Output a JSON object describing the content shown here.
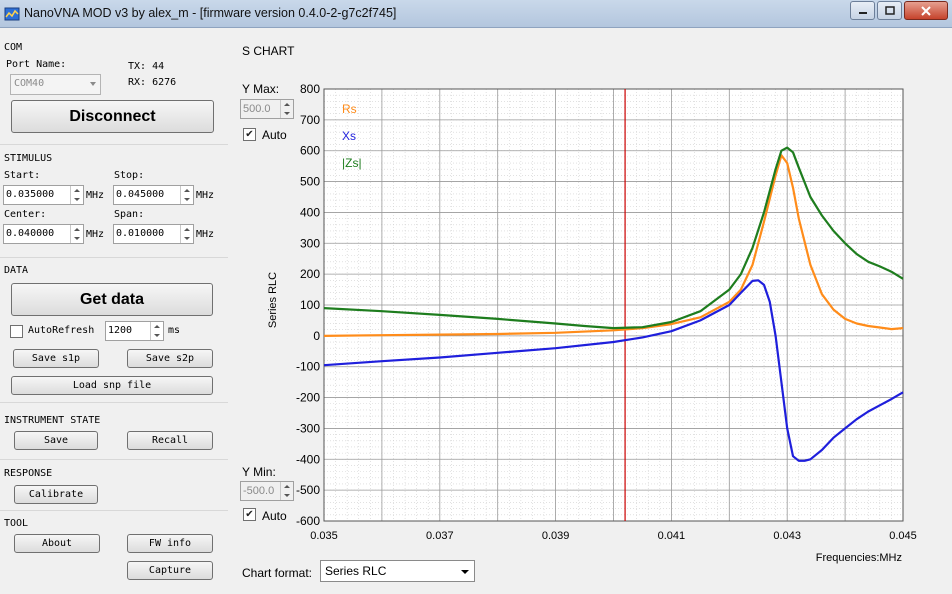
{
  "window": {
    "title": "NanoVNA MOD v3 by alex_m - [firmware version 0.4.0-2-g7c2f745]",
    "accent": "#b3c6de"
  },
  "com": {
    "title": "COM",
    "port_label": "Port Name:",
    "port_value": "COM40",
    "tx": "TX: 44",
    "rx": "RX: 6276",
    "disconnect_label": "Disconnect"
  },
  "stimulus": {
    "title": "STIMULUS",
    "start_label": "Start:",
    "start_value": "0.035000",
    "stop_label": "Stop:",
    "stop_value": "0.045000",
    "center_label": "Center:",
    "center_value": "0.040000",
    "span_label": "Span:",
    "span_value": "0.010000",
    "unit": "MHz"
  },
  "data_section": {
    "title": "DATA",
    "get_data_label": "Get data",
    "autorefresh_label": "AutoRefresh",
    "autorefresh_checked": false,
    "interval_value": "1200",
    "interval_unit": "ms",
    "save_s1p_label": "Save s1p",
    "save_s2p_label": "Save s2p",
    "load_snp_label": "Load snp file"
  },
  "instrument_state": {
    "title": "INSTRUMENT STATE",
    "save_label": "Save",
    "recall_label": "Recall"
  },
  "response": {
    "title": "RESPONSE",
    "calibrate_label": "Calibrate"
  },
  "tool": {
    "title": "TOOL",
    "about_label": "About",
    "fw_info_label": "FW info",
    "capture_label": "Capture"
  },
  "chart_panel": {
    "title": "S CHART",
    "y_max_label": "Y Max:",
    "y_max_value": "500.0",
    "y_max_auto_label": "Auto",
    "y_max_auto_checked": true,
    "y_min_label": "Y Min:",
    "y_min_value": "-500.0",
    "y_min_auto_label": "Auto",
    "y_min_auto_checked": true,
    "format_label": "Chart format:",
    "format_value": "Series RLC"
  },
  "chart_data": {
    "type": "line",
    "title": "",
    "xlabel": "Frequencies:MHz",
    "ylabel": "Series RLC",
    "xlim": [
      0.035,
      0.045
    ],
    "ylim": [
      -600,
      800
    ],
    "x_ticks": [
      "0.035",
      "0.037",
      "0.039",
      "0.041",
      "0.043",
      "0.045"
    ],
    "x_tick_values": [
      0.035,
      0.037,
      0.039,
      0.041,
      0.043,
      0.045
    ],
    "y_ticks": [
      800,
      700,
      600,
      500,
      400,
      300,
      200,
      100,
      0,
      -100,
      -200,
      -300,
      -400,
      -500,
      -600
    ],
    "grid": true,
    "legend_position": "top-left",
    "marker_x": 0.0402,
    "marker_color": "#cc0000",
    "series": [
      {
        "name": "Rs",
        "color": "#ff8c1a",
        "x": [
          0.035,
          0.036,
          0.037,
          0.038,
          0.039,
          0.04,
          0.0405,
          0.041,
          0.0415,
          0.042,
          0.0422,
          0.0424,
          0.0426,
          0.0428,
          0.0429,
          0.043,
          0.0431,
          0.0432,
          0.0434,
          0.0436,
          0.0438,
          0.044,
          0.0442,
          0.0444,
          0.0446,
          0.0448,
          0.045
        ],
        "y": [
          0,
          2,
          4,
          6,
          10,
          18,
          25,
          38,
          60,
          110,
          150,
          230,
          370,
          520,
          585,
          560,
          480,
          380,
          230,
          135,
          85,
          55,
          40,
          32,
          27,
          22,
          25
        ]
      },
      {
        "name": "Xs",
        "color": "#1f1fdc",
        "x": [
          0.035,
          0.036,
          0.037,
          0.038,
          0.039,
          0.04,
          0.0405,
          0.041,
          0.0415,
          0.042,
          0.0422,
          0.0424,
          0.0425,
          0.0426,
          0.0427,
          0.0428,
          0.0429,
          0.043,
          0.0431,
          0.0432,
          0.0433,
          0.0434,
          0.0436,
          0.0438,
          0.044,
          0.0442,
          0.0444,
          0.0446,
          0.0448,
          0.045
        ],
        "y": [
          -95,
          -82,
          -70,
          -55,
          -40,
          -20,
          -5,
          15,
          50,
          100,
          140,
          178,
          180,
          165,
          110,
          0,
          -150,
          -300,
          -390,
          -405,
          -405,
          -400,
          -370,
          -330,
          -300,
          -270,
          -245,
          -225,
          -205,
          -183
        ]
      },
      {
        "name": "|Zs|",
        "color": "#1e7d1e",
        "x": [
          0.035,
          0.036,
          0.037,
          0.038,
          0.039,
          0.0395,
          0.04,
          0.0405,
          0.041,
          0.0415,
          0.042,
          0.0422,
          0.0424,
          0.0426,
          0.0428,
          0.0429,
          0.043,
          0.0431,
          0.0432,
          0.0434,
          0.0436,
          0.0438,
          0.044,
          0.0442,
          0.0444,
          0.0446,
          0.0448,
          0.045
        ],
        "y": [
          90,
          80,
          68,
          55,
          40,
          32,
          25,
          28,
          45,
          80,
          150,
          200,
          285,
          400,
          540,
          600,
          610,
          595,
          545,
          450,
          390,
          340,
          300,
          265,
          240,
          225,
          208,
          185
        ]
      }
    ]
  }
}
